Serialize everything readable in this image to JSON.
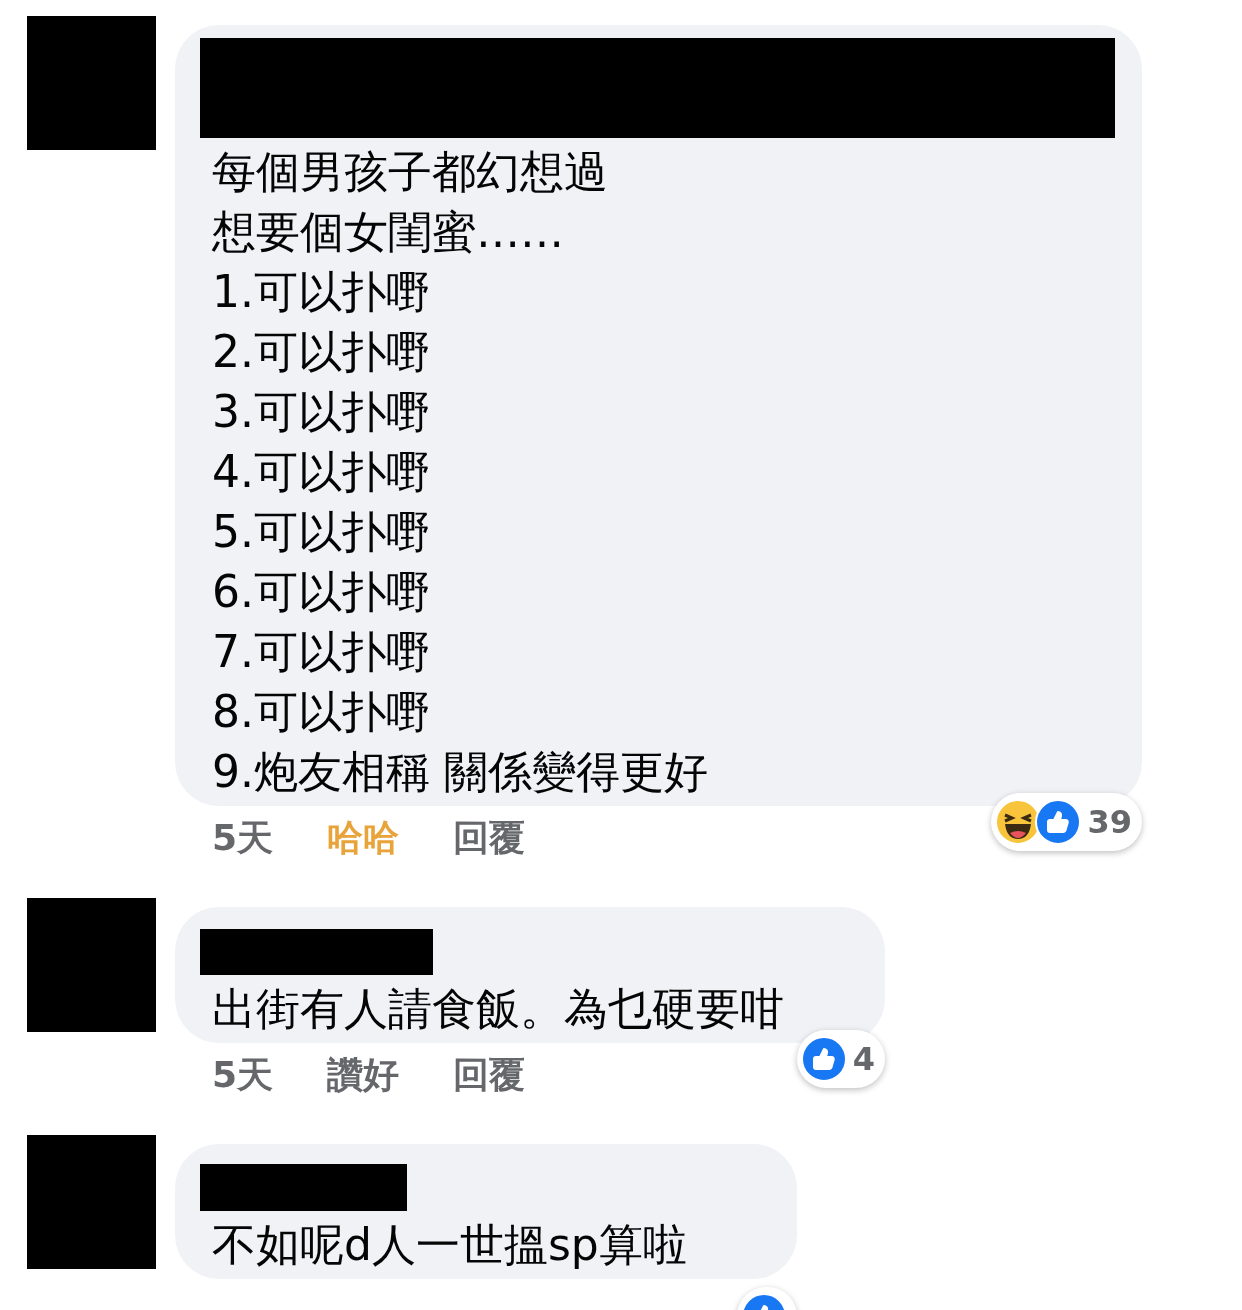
{
  "comments": [
    {
      "lines": [
        "每個男孩子都幻想過",
        "想要個女閨蜜……",
        "1.可以扑嘢",
        "2.可以扑嘢",
        "3.可以扑嘢",
        "4.可以扑嘢",
        "5.可以扑嘢",
        "6.可以扑嘢",
        "7.可以扑嘢",
        "8.可以扑嘢",
        "9.炮友相稱 關係變得更好"
      ],
      "time": "5天",
      "react": {
        "label": "哈哈",
        "selected": true
      },
      "reply": "回覆",
      "reactions": {
        "icons": [
          {
            "kind": "haha"
          },
          {
            "kind": "like"
          }
        ],
        "count": "39"
      }
    },
    {
      "lines": [
        "出街有人請食飯。為乜硬要咁"
      ],
      "time": "5天",
      "react": {
        "label": "讚好",
        "selected": false
      },
      "reply": "回覆",
      "reactions": {
        "icons": [
          {
            "kind": "like"
          }
        ],
        "count": "4"
      }
    },
    {
      "lines": [
        "不如呢d人一世搵sp算啦"
      ],
      "reactions": {
        "icons": [
          {
            "kind": "like"
          }
        ]
      }
    }
  ]
}
